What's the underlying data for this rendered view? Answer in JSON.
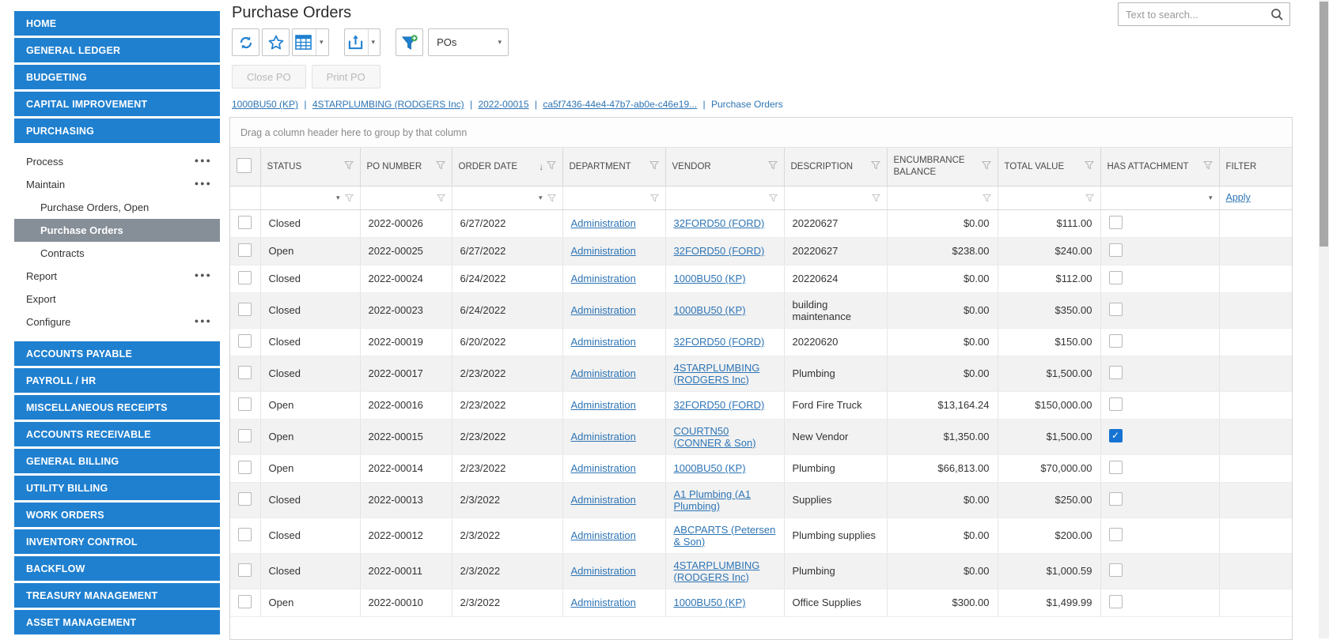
{
  "app": {
    "title": "Purchase Orders",
    "search": {
      "placeholder": "Text to search..."
    }
  },
  "colors": {
    "accent_blue": "#1f80d0",
    "selected_item_gray": "#868e98",
    "link_blue": "#2e75b5",
    "checked_checkbox_blue": "#1673d2",
    "filter_add_green": "#3aa655"
  },
  "sidebar": {
    "modules_top": [
      {
        "label": "HOME"
      },
      {
        "label": "GENERAL LEDGER"
      },
      {
        "label": "BUDGETING"
      },
      {
        "label": "CAPITAL IMPROVEMENT"
      },
      {
        "label": "PURCHASING"
      }
    ],
    "purchasing_menu": [
      {
        "label": "Process",
        "ellipsis": true
      },
      {
        "label": "Maintain",
        "ellipsis": true
      },
      {
        "label": "Purchase Orders, Open",
        "indent": true
      },
      {
        "label": "Purchase Orders",
        "indent": true,
        "selected": true
      },
      {
        "label": "Contracts",
        "indent": true
      },
      {
        "label": "Report",
        "ellipsis": true
      },
      {
        "label": "Export"
      },
      {
        "label": "Configure",
        "ellipsis": true
      }
    ],
    "modules_bottom": [
      {
        "label": "ACCOUNTS PAYABLE"
      },
      {
        "label": "PAYROLL / HR"
      },
      {
        "label": "MISCELLANEOUS RECEIPTS"
      },
      {
        "label": "ACCOUNTS RECEIVABLE"
      },
      {
        "label": "GENERAL BILLING"
      },
      {
        "label": "UTILITY BILLING"
      },
      {
        "label": "WORK ORDERS"
      },
      {
        "label": "INVENTORY CONTROL"
      },
      {
        "label": "BACKFLOW"
      },
      {
        "label": "TREASURY MANAGEMENT"
      },
      {
        "label": "ASSET MANAGEMENT"
      }
    ]
  },
  "toolbar": {
    "icons": [
      "refresh-icon",
      "star-favorite-icon",
      "table-view-icon",
      "export-icon",
      "filter-add-icon"
    ],
    "view_select_value": "POs"
  },
  "actions": {
    "close_po": "Close PO",
    "print_po": "Print PO"
  },
  "breadcrumb": {
    "links": [
      {
        "text": "1000BU50 (KP)"
      },
      {
        "text": "4STARPLUMBING (RODGERS Inc)"
      },
      {
        "text": "2022-00015"
      },
      {
        "text": "ca5f7436-44e4-47b7-ab0e-c46e19..."
      }
    ],
    "separator": "|",
    "current": "Purchase Orders"
  },
  "grid": {
    "group_hint": "Drag a column header here to group by that column",
    "columns": [
      {
        "label": ""
      },
      {
        "label": "STATUS"
      },
      {
        "label": "PO NUMBER"
      },
      {
        "label": "ORDER DATE",
        "sort": "desc"
      },
      {
        "label": "DEPARTMENT"
      },
      {
        "label": "VENDOR"
      },
      {
        "label": "DESCRIPTION"
      },
      {
        "label": "ENCUMBRANCE BALANCE"
      },
      {
        "label": "TOTAL VALUE"
      },
      {
        "label": "HAS ATTACHMENT"
      },
      {
        "label": "FILTER"
      }
    ],
    "filter_row": {
      "apply_label": "Apply"
    },
    "rows": [
      {
        "status": "Closed",
        "po_number": "2022-00026",
        "order_date": "6/27/2022",
        "department": "Administration",
        "vendor": "32FORD50 (FORD)",
        "description": "20220627",
        "encumbrance_balance": "$0.00",
        "total_value": "$111.00",
        "has_attachment": false
      },
      {
        "status": "Open",
        "po_number": "2022-00025",
        "order_date": "6/27/2022",
        "department": "Administration",
        "vendor": "32FORD50 (FORD)",
        "description": "20220627",
        "encumbrance_balance": "$238.00",
        "total_value": "$240.00",
        "has_attachment": false
      },
      {
        "status": "Closed",
        "po_number": "2022-00024",
        "order_date": "6/24/2022",
        "department": "Administration",
        "vendor": "1000BU50 (KP)",
        "description": "20220624",
        "encumbrance_balance": "$0.00",
        "total_value": "$112.00",
        "has_attachment": false
      },
      {
        "status": "Closed",
        "po_number": "2022-00023",
        "order_date": "6/24/2022",
        "department": "Administration",
        "vendor": "1000BU50 (KP)",
        "description": "building maintenance",
        "encumbrance_balance": "$0.00",
        "total_value": "$350.00",
        "has_attachment": false
      },
      {
        "status": "Closed",
        "po_number": "2022-00019",
        "order_date": "6/20/2022",
        "department": "Administration",
        "vendor": "32FORD50 (FORD)",
        "description": "20220620",
        "encumbrance_balance": "$0.00",
        "total_value": "$150.00",
        "has_attachment": false
      },
      {
        "status": "Closed",
        "po_number": "2022-00017",
        "order_date": "2/23/2022",
        "department": "Administration",
        "vendor": "4STARPLUMBING (RODGERS Inc)",
        "description": "Plumbing",
        "encumbrance_balance": "$0.00",
        "total_value": "$1,500.00",
        "has_attachment": false
      },
      {
        "status": "Open",
        "po_number": "2022-00016",
        "order_date": "2/23/2022",
        "department": "Administration",
        "vendor": "32FORD50 (FORD)",
        "description": "Ford Fire Truck",
        "encumbrance_balance": "$13,164.24",
        "total_value": "$150,000.00",
        "has_attachment": false
      },
      {
        "status": "Open",
        "po_number": "2022-00015",
        "order_date": "2/23/2022",
        "department": "Administration",
        "vendor": "COURTN50 (CONNER & Son)",
        "description": "New Vendor",
        "encumbrance_balance": "$1,350.00",
        "total_value": "$1,500.00",
        "has_attachment": true
      },
      {
        "status": "Open",
        "po_number": "2022-00014",
        "order_date": "2/23/2022",
        "department": "Administration",
        "vendor": "1000BU50 (KP)",
        "description": "Plumbing",
        "encumbrance_balance": "$66,813.00",
        "total_value": "$70,000.00",
        "has_attachment": false
      },
      {
        "status": "Closed",
        "po_number": "2022-00013",
        "order_date": "2/3/2022",
        "department": "Administration",
        "vendor": "A1 Plumbing (A1 Plumbing)",
        "description": "Supplies",
        "encumbrance_balance": "$0.00",
        "total_value": "$250.00",
        "has_attachment": false
      },
      {
        "status": "Closed",
        "po_number": "2022-00012",
        "order_date": "2/3/2022",
        "department": "Administration",
        "vendor": "ABCPARTS (Petersen & Son)",
        "description": "Plumbing supplies",
        "encumbrance_balance": "$0.00",
        "total_value": "$200.00",
        "has_attachment": false
      },
      {
        "status": "Closed",
        "po_number": "2022-00011",
        "order_date": "2/3/2022",
        "department": "Administration",
        "vendor": "4STARPLUMBING (RODGERS Inc)",
        "description": "Plumbing",
        "encumbrance_balance": "$0.00",
        "total_value": "$1,000.59",
        "has_attachment": false
      },
      {
        "status": "Open",
        "po_number": "2022-00010",
        "order_date": "2/3/2022",
        "department": "Administration",
        "vendor": "1000BU50 (KP)",
        "description": "Office Supplies",
        "encumbrance_balance": "$300.00",
        "total_value": "$1,499.99",
        "has_attachment": false
      }
    ]
  }
}
